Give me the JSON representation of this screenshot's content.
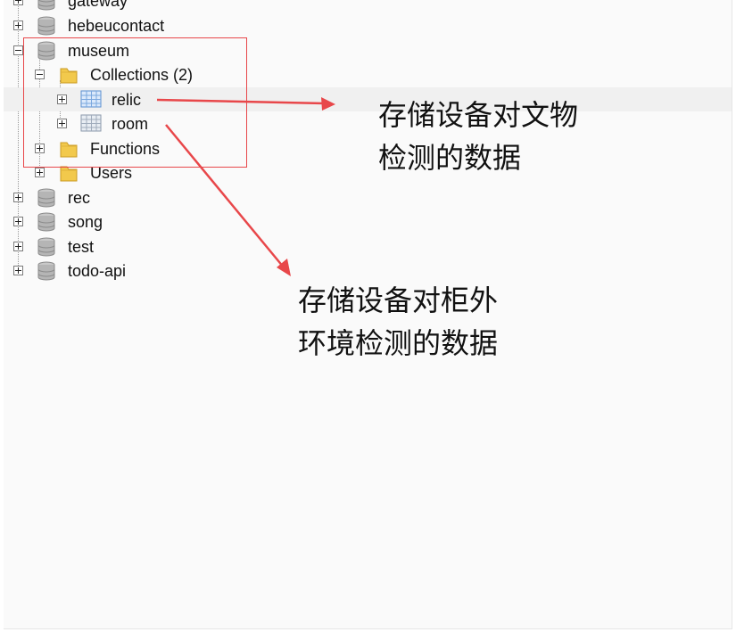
{
  "tree": {
    "items": [
      {
        "label": "gateway",
        "type": "database",
        "expanded": false
      },
      {
        "label": "hebeucontact",
        "type": "database",
        "expanded": false
      },
      {
        "label": "museum",
        "type": "database",
        "expanded": true
      },
      {
        "label": "Collections (2)",
        "type": "folder",
        "expanded": true
      },
      {
        "label": "relic",
        "type": "collection",
        "expanded": false
      },
      {
        "label": "room",
        "type": "collection",
        "expanded": false
      },
      {
        "label": "Functions",
        "type": "folder",
        "expanded": false
      },
      {
        "label": "Users",
        "type": "folder",
        "expanded": false
      },
      {
        "label": "rec",
        "type": "database",
        "expanded": false
      },
      {
        "label": "song",
        "type": "database",
        "expanded": false
      },
      {
        "label": "test",
        "type": "database",
        "expanded": false
      },
      {
        "label": "todo-api",
        "type": "database",
        "expanded": false
      }
    ]
  },
  "annotations": {
    "relic_note": "存储设备对文物\n检测的数据",
    "room_note": "存储设备对柜外\n环境检测的数据"
  },
  "colors": {
    "annotation_red": "#e8474a",
    "folder_yellow": "#f2c94c",
    "db_gray": "#a8a8a8"
  }
}
